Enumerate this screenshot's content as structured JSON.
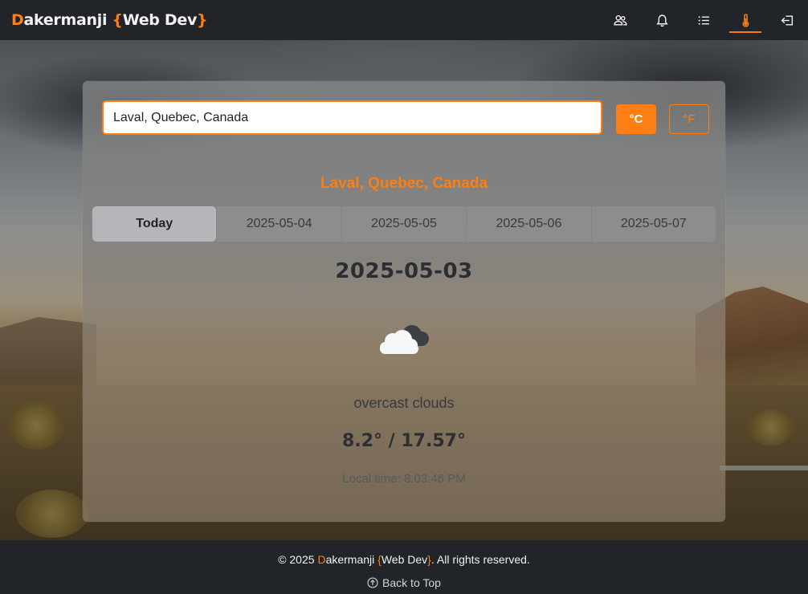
{
  "brand": {
    "first_letter": "D",
    "rest": "akermanji ",
    "brace_open": "{",
    "label": "Web Dev",
    "brace_close": "}"
  },
  "nav": {
    "icons": [
      "users-icon",
      "bell-icon",
      "list-icon",
      "thermometer-icon",
      "logout-icon"
    ],
    "active": "thermometer-icon"
  },
  "search": {
    "value": "Laval, Quebec, Canada",
    "placeholder": ""
  },
  "units": {
    "celsius": "°C",
    "fahrenheit": "°F",
    "selected": "celsius"
  },
  "location_title": "Laval, Quebec, Canada",
  "tabs": [
    {
      "label": "Today",
      "active": true
    },
    {
      "label": "2025-05-04",
      "active": false
    },
    {
      "label": "2025-05-05",
      "active": false
    },
    {
      "label": "2025-05-06",
      "active": false
    },
    {
      "label": "2025-05-07",
      "active": false
    }
  ],
  "forecast": {
    "date": "2025-05-03",
    "icon": "overcast-clouds-icon",
    "description": "overcast clouds",
    "temperature": "8.2° / 17.57°",
    "local_time": "Local time: 8:03:46 PM"
  },
  "footer": {
    "copyright_prefix": "© 2025 ",
    "first_letter": "D",
    "rest": "akermanji ",
    "brace_open": "{",
    "label": "Web Dev",
    "brace_close": "}",
    "suffix": ". All rights reserved.",
    "back_to_top": "Back to Top"
  },
  "colors": {
    "accent": "#fd7e14",
    "navbar": "#212529"
  }
}
